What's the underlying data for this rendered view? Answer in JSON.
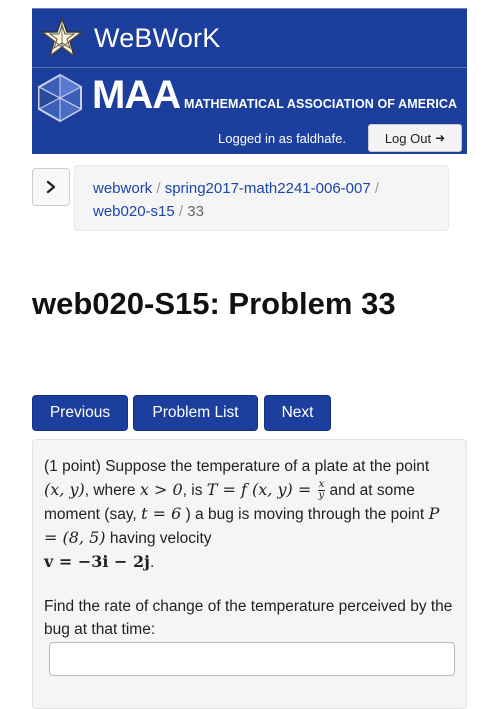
{
  "header": {
    "app_title": "WeBWorK",
    "maa_short": "MAA",
    "maa_full": "MATHEMATICAL ASSOCIATION OF AMERICA",
    "logged_in_text": "Logged in as faldhafe.",
    "logout_label": "Log Out",
    "background_color": "#1c3e9c"
  },
  "nav_toggle": {
    "icon": "chevron-right-icon"
  },
  "breadcrumb": {
    "items": [
      "webwork",
      "spring2017-math2241-006-007",
      "web020-s15"
    ],
    "separator": "/",
    "current": "33"
  },
  "page_title": "web020-S15: Problem 33",
  "nav_buttons": {
    "previous": "Previous",
    "problem_list": "Problem List",
    "next": "Next",
    "color": "#1c3e9c"
  },
  "problem": {
    "points": "(1 point)",
    "intro": "Suppose the temperature of a plate at the point",
    "point_expr": "(x, y)",
    "where": ", where",
    "condition": "x > 0",
    "is_text": ", is",
    "temp_expr": "T = f (x, y) =",
    "frac_num": "x",
    "frac_den": "y",
    "moment_text": "and at some moment (say,",
    "time_expr": "t = 6",
    "bug_text": ") a bug is moving through the point",
    "point_p": "P = (8, 5)",
    "velocity_text": "having velocity",
    "velocity_expr": "v = −3i − 2j",
    "period": ".",
    "question": "Find the rate of change of the temperature perceived by the bug at that time:",
    "answer_value": ""
  }
}
